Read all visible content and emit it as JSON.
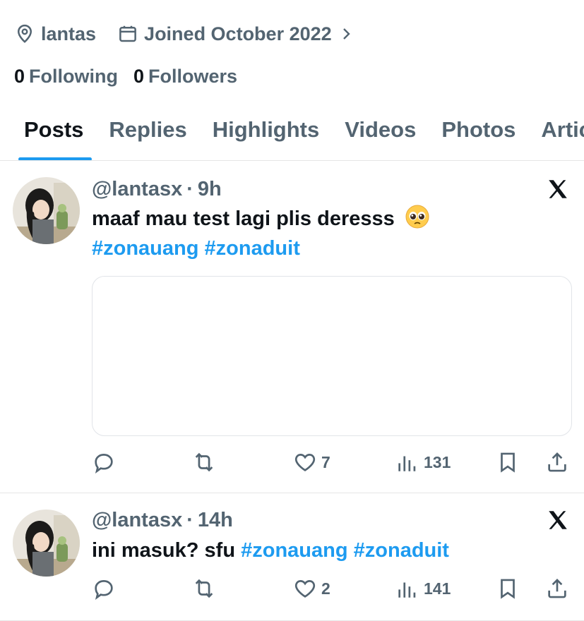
{
  "profile": {
    "location": "lantas",
    "joined": "Joined October 2022",
    "following_count": "0",
    "following_label": "Following",
    "followers_count": "0",
    "followers_label": "Followers"
  },
  "tabs": [
    {
      "label": "Posts",
      "active": true
    },
    {
      "label": "Replies"
    },
    {
      "label": "Highlights"
    },
    {
      "label": "Videos"
    },
    {
      "label": "Photos"
    },
    {
      "label": "Articles"
    }
  ],
  "posts": [
    {
      "handle": "@lantasx",
      "separator": "·",
      "time": "9h",
      "text": "maaf mau test lagi plis deresss",
      "emoji": "🥺",
      "tags": [
        "#zonauang",
        "#zonaduit"
      ],
      "likes": "7",
      "views": "131"
    },
    {
      "handle": "@lantasx",
      "separator": "·",
      "time": "14h",
      "text": "ini masuk? sfu",
      "tags": [
        "#zonauang",
        "#zonaduit"
      ],
      "likes": "2",
      "views": "141"
    }
  ],
  "icons": {
    "location": "location-pin-icon",
    "calendar": "calendar-icon",
    "chevron": "chevron-right-icon",
    "reply": "reply-icon",
    "repost": "repost-icon",
    "like": "heart-icon",
    "views": "views-icon",
    "bookmark": "bookmark-icon",
    "share": "share-icon",
    "brand": "x-logo-icon"
  },
  "colors": {
    "accent": "#1d9bf0",
    "muted": "#536471",
    "text": "#0f1419",
    "divider": "#e6e6e6"
  }
}
